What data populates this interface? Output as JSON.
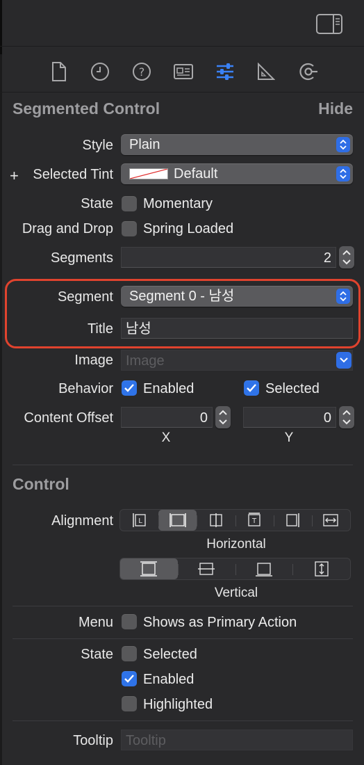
{
  "toolbar": {
    "inspector_toggle_icon": "sidebar-right-icon"
  },
  "tabs": [
    {
      "icon": "file-icon",
      "selected": false
    },
    {
      "icon": "clock-icon",
      "selected": false
    },
    {
      "icon": "help-icon",
      "selected": false
    },
    {
      "icon": "identity-icon",
      "selected": false
    },
    {
      "icon": "sliders-icon",
      "selected": true
    },
    {
      "icon": "ruler-icon",
      "selected": false
    },
    {
      "icon": "connections-icon",
      "selected": false
    }
  ],
  "segmented_control": {
    "title": "Segmented Control",
    "hide": "Hide",
    "style_label": "Style",
    "style_value": "Plain",
    "tint_plus": "+",
    "tint_label": "Selected Tint",
    "tint_value": "Default",
    "state_label": "State",
    "momentary": "Momentary",
    "drag_label": "Drag and Drop",
    "spring_loaded": "Spring Loaded",
    "segments_label": "Segments",
    "segments_value": "2",
    "segment_label": "Segment",
    "segment_value": "Segment 0 - 남성",
    "title_label": "Title",
    "title_value": "남성",
    "image_label": "Image",
    "image_placeholder": "Image",
    "behavior_label": "Behavior",
    "enabled": "Enabled",
    "selected": "Selected",
    "enabled_checked": true,
    "selected_checked": true,
    "offset_label": "Content Offset",
    "offset_x": "0",
    "offset_y": "0",
    "x_label": "X",
    "y_label": "Y"
  },
  "control": {
    "title": "Control",
    "alignment_label": "Alignment",
    "horizontal_label": "Horizontal",
    "vertical_label": "Vertical",
    "horizontal_selected_index": 1,
    "vertical_selected_index": 0,
    "menu_label": "Menu",
    "menu_option": "Shows as Primary Action",
    "state_label": "State",
    "state_selected": "Selected",
    "state_enabled": "Enabled",
    "state_highlighted": "Highlighted",
    "state_enabled_checked": true,
    "tooltip_label": "Tooltip",
    "tooltip_placeholder": "Tooltip"
  },
  "colors": {
    "accent": "#2f73e8",
    "highlight_ring": "#e0432e",
    "background": "#29292b"
  }
}
